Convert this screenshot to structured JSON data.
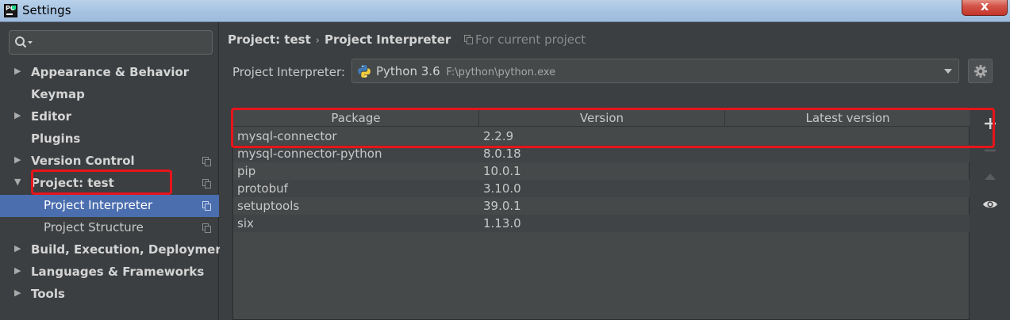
{
  "window": {
    "title": "Settings",
    "close_label": "x"
  },
  "sidebar": {
    "search_placeholder": "",
    "items": [
      {
        "label": "Appearance & Behavior",
        "bold": true,
        "arrow": "collapsed"
      },
      {
        "label": "Keymap",
        "bold": true,
        "arrow": "none"
      },
      {
        "label": "Editor",
        "bold": true,
        "arrow": "collapsed"
      },
      {
        "label": "Plugins",
        "bold": true,
        "arrow": "none"
      },
      {
        "label": "Version Control",
        "bold": true,
        "arrow": "collapsed",
        "copy_icon": true
      },
      {
        "label": "Project: test",
        "bold": true,
        "arrow": "expanded",
        "copy_icon": true
      },
      {
        "label": "Project Interpreter",
        "bold": false,
        "selected": true,
        "copy_icon": true
      },
      {
        "label": "Project Structure",
        "bold": false,
        "copy_icon": true
      },
      {
        "label": "Build, Execution, Deployment",
        "bold": true,
        "arrow": "collapsed"
      },
      {
        "label": "Languages & Frameworks",
        "bold": true,
        "arrow": "collapsed"
      },
      {
        "label": "Tools",
        "bold": true,
        "arrow": "collapsed"
      }
    ]
  },
  "breadcrumb": {
    "project": "Project: test",
    "separator": "›",
    "page": "Project Interpreter",
    "note": "For current project"
  },
  "interpreter": {
    "label": "Project Interpreter:",
    "name": "Python 3.6",
    "path": "F:\\python\\python.exe"
  },
  "table": {
    "headers": [
      "Package",
      "Version",
      "Latest version"
    ],
    "rows": [
      [
        "mysql-connector",
        "2.2.9",
        ""
      ],
      [
        "mysql-connector-python",
        "8.0.18",
        ""
      ],
      [
        "pip",
        "10.0.1",
        ""
      ],
      [
        "protobuf",
        "3.10.0",
        ""
      ],
      [
        "setuptools",
        "39.0.1",
        ""
      ],
      [
        "six",
        "1.13.0",
        ""
      ]
    ]
  },
  "colors": {
    "background": "#3c3f41",
    "selection": "#4b6eaf",
    "highlight_box": "#e8141b"
  }
}
